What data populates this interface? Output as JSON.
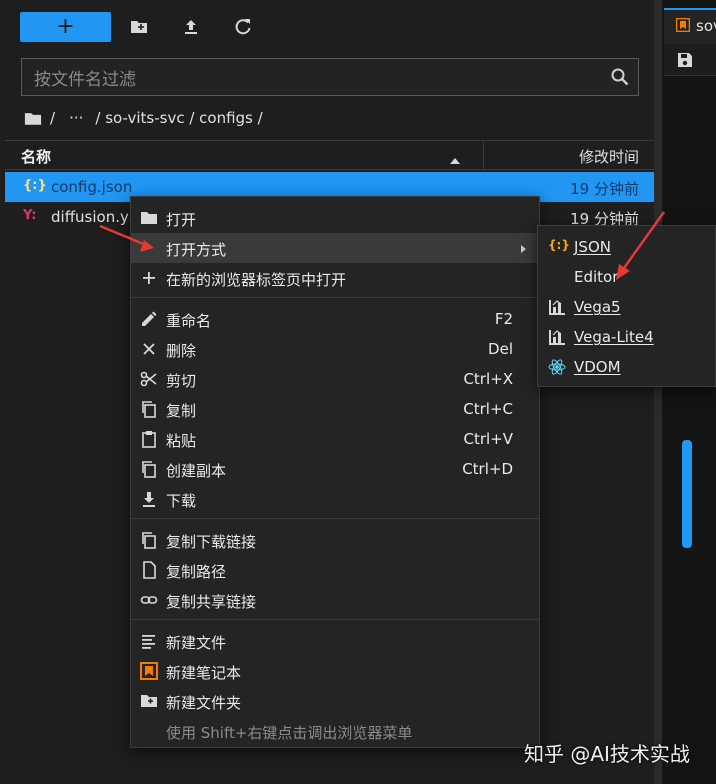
{
  "toolbar": {
    "new_label": "+",
    "icons": [
      "new-folder-icon",
      "upload-icon",
      "refresh-icon"
    ]
  },
  "filter": {
    "placeholder": "按文件名过滤"
  },
  "breadcrumb": {
    "root": "/",
    "ellipsis": "···",
    "path": "/ so-vits-svc / configs /"
  },
  "list_header": {
    "name": "名称",
    "modified": "修改时间"
  },
  "files": [
    {
      "icon_text": "{:}",
      "name": "config.json",
      "modified": "19 分钟前",
      "selected": true
    },
    {
      "icon_text": "Y:",
      "name": "diffusion.ya",
      "modified": "19 分钟前",
      "selected": false
    }
  ],
  "context_menu": {
    "open": "打开",
    "open_with": "打开方式",
    "open_new_tab": "在新的浏览器标签页中打开",
    "rename": "重命名",
    "rename_shortcut": "F2",
    "delete": "删除",
    "delete_shortcut": "Del",
    "cut": "剪切",
    "cut_shortcut": "Ctrl+X",
    "copy": "复制",
    "copy_shortcut": "Ctrl+C",
    "paste": "粘贴",
    "paste_shortcut": "Ctrl+V",
    "duplicate": "创建副本",
    "duplicate_shortcut": "Ctrl+D",
    "download": "下载",
    "copy_download_link": "复制下载链接",
    "copy_path": "复制路径",
    "copy_share_link": "复制共享链接",
    "new_file": "新建文件",
    "new_notebook": "新建笔记本",
    "new_folder": "新建文件夹",
    "hint": "使用 Shift+右键点击调出浏览器菜单"
  },
  "submenu": {
    "json": "JSON",
    "editor": "Editor",
    "vega5": "Vega5",
    "vega_lite4": "Vega-Lite4",
    "vdom": "VDOM"
  },
  "right_panel": {
    "tab_label": "sov"
  },
  "watermark": "知乎 @AI技术实战",
  "colors": {
    "accent": "#2196f3",
    "menu_bg": "#242424",
    "notebook_orange": "#f57c00",
    "annotation_red": "#e53935"
  }
}
